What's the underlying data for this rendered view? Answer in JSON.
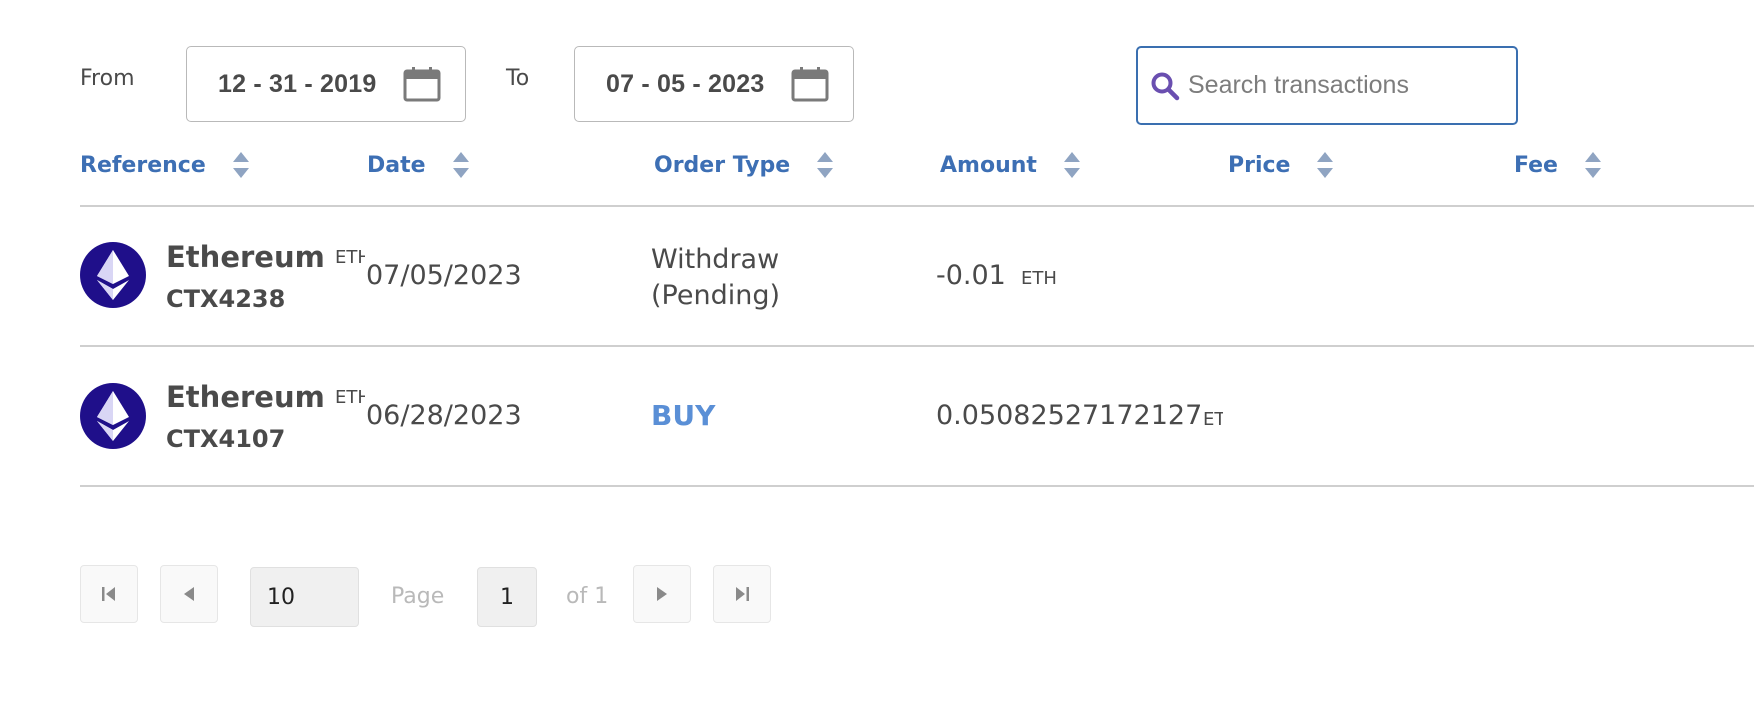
{
  "filters": {
    "from_label": "From",
    "from_date": "12 - 31 - 2019",
    "to_label": "To",
    "to_date": "07 - 05 - 2023",
    "search_placeholder": "Search transactions",
    "search_value": ""
  },
  "table": {
    "columns": [
      "Reference",
      "Date",
      "Order Type",
      "Amount",
      "Price",
      "Fee"
    ],
    "rows": [
      {
        "coin_name": "Ethereum",
        "coin_ticker": "ETH",
        "reference": "CTX4238",
        "date": "07/05/2023",
        "order_type": "Withdraw (Pending)",
        "amount": "-0.01",
        "amount_unit": "ETH",
        "price": "",
        "fee": ""
      },
      {
        "coin_name": "Ethereum",
        "coin_ticker": "ETH",
        "reference": "CTX4107",
        "date": "06/28/2023",
        "order_type": "BUY",
        "amount": "0.05082527172127",
        "amount_unit": "ETH",
        "price": "",
        "fee": ""
      }
    ]
  },
  "pagination": {
    "page_size": "10",
    "page_label": "Page",
    "current_page": "1",
    "of_label": "of 1"
  },
  "icons": {
    "calendar": "calendar-icon",
    "search": "search-icon",
    "sort": "sort-icon",
    "coin": "ethereum-icon",
    "first": "first-page-icon",
    "prev": "prev-page-icon",
    "next": "next-page-icon",
    "last": "last-page-icon"
  },
  "colors": {
    "accent": "#3d6fb4",
    "buy": "#5a8fd6",
    "coin_bg": "#1f0f8a",
    "search_border": "#3a6fb0"
  }
}
